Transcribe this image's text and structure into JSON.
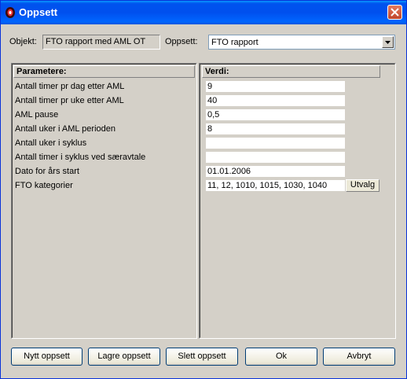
{
  "window": {
    "title": "Oppsett",
    "title_icon": "app-icon",
    "close_icon": "close-icon"
  },
  "header": {
    "objekt_label": "Objekt:",
    "objekt_value": "FTO rapport med AML OT",
    "oppsett_label": "Oppsett:",
    "oppsett_value": "FTO rapport"
  },
  "table": {
    "param_header": "Parametere:",
    "value_header": "Verdi:",
    "rows": [
      {
        "param": "Antall timer pr dag etter AML",
        "value": "9"
      },
      {
        "param": "Antall timer pr uke etter AML",
        "value": "40"
      },
      {
        "param": "AML pause",
        "value": "0,5"
      },
      {
        "param": "Antall uker i AML perioden",
        "value": "8"
      },
      {
        "param": "Antall uker i syklus",
        "value": ""
      },
      {
        "param": "Antall timer i syklus ved særavtale",
        "value": ""
      },
      {
        "param": "Dato for års start",
        "value": "01.01.2006"
      },
      {
        "param": "FTO kategorier",
        "value": "11, 12, 1010, 1015, 1030, 1040"
      }
    ],
    "utvalg_button": "Utvalg"
  },
  "buttons": {
    "new": "Nytt oppsett",
    "save": "Lagre oppsett",
    "delete": "Slett oppsett",
    "ok": "Ok",
    "cancel": "Avbryt"
  }
}
